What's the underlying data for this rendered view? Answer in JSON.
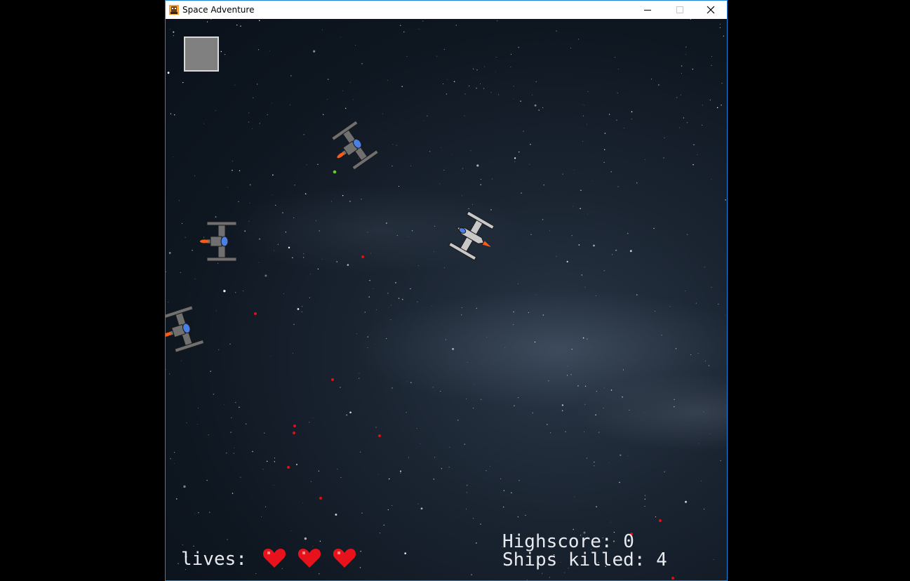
{
  "window": {
    "title": "Space Adventure"
  },
  "hud": {
    "lives_label": "lives:",
    "lives_count": 3,
    "highscore_label": "Highscore:",
    "highscore_value": "0",
    "ships_killed_label": "Ships killed:",
    "ships_killed_value": "4"
  },
  "colors": {
    "hud_text": "#e8eaee",
    "heart": "#e8121c",
    "enemy_bullet": "#e01010",
    "player_bullet": "#5fd21f",
    "ship_dark": "#707070",
    "ship_light": "#c8c8c8",
    "thruster": "#ff5a14",
    "cockpit": "#4a7fe6"
  },
  "icons": {
    "app": "space-adventure-app-icon",
    "minimize": "minimize-icon",
    "maximize": "maximize-icon",
    "close": "close-icon",
    "heart": "heart-icon"
  }
}
